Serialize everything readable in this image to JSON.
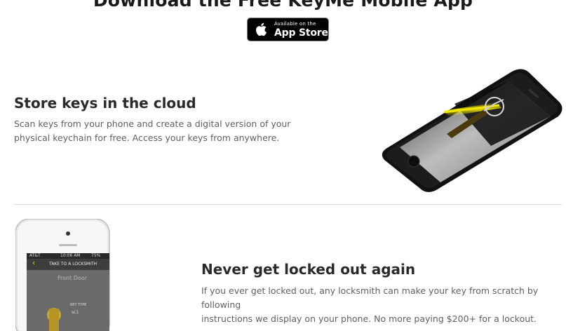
{
  "header": {
    "title": "Download the Free KeyMe Mobile App",
    "appstore_small": "Available on the",
    "appstore_big": "App Store"
  },
  "section1": {
    "heading": "Store keys in the cloud",
    "line1": "Scan keys from your phone and create a digital version of your",
    "line2": "physical keychain for free. Access your keys from anywhere."
  },
  "section2": {
    "heading": "Never get locked out again",
    "line1": "If you ever get locked out, any locksmith can make your key from scratch by following",
    "line2": "instructions we display on your phone. No more paying $200+ for a lockout."
  },
  "phone2": {
    "carrier": "AT&T",
    "time": "10:06 AM",
    "battery": "75%",
    "nav_title": "TAKE TO A LOCKSMITH",
    "key_name": "Front Door",
    "key_type_label": "KEY TYPE",
    "key_type_value": "sc1"
  },
  "colors": {
    "scan_line": "#f2e600",
    "phone_black": "#111111",
    "text_body": "#5f5f5f"
  }
}
